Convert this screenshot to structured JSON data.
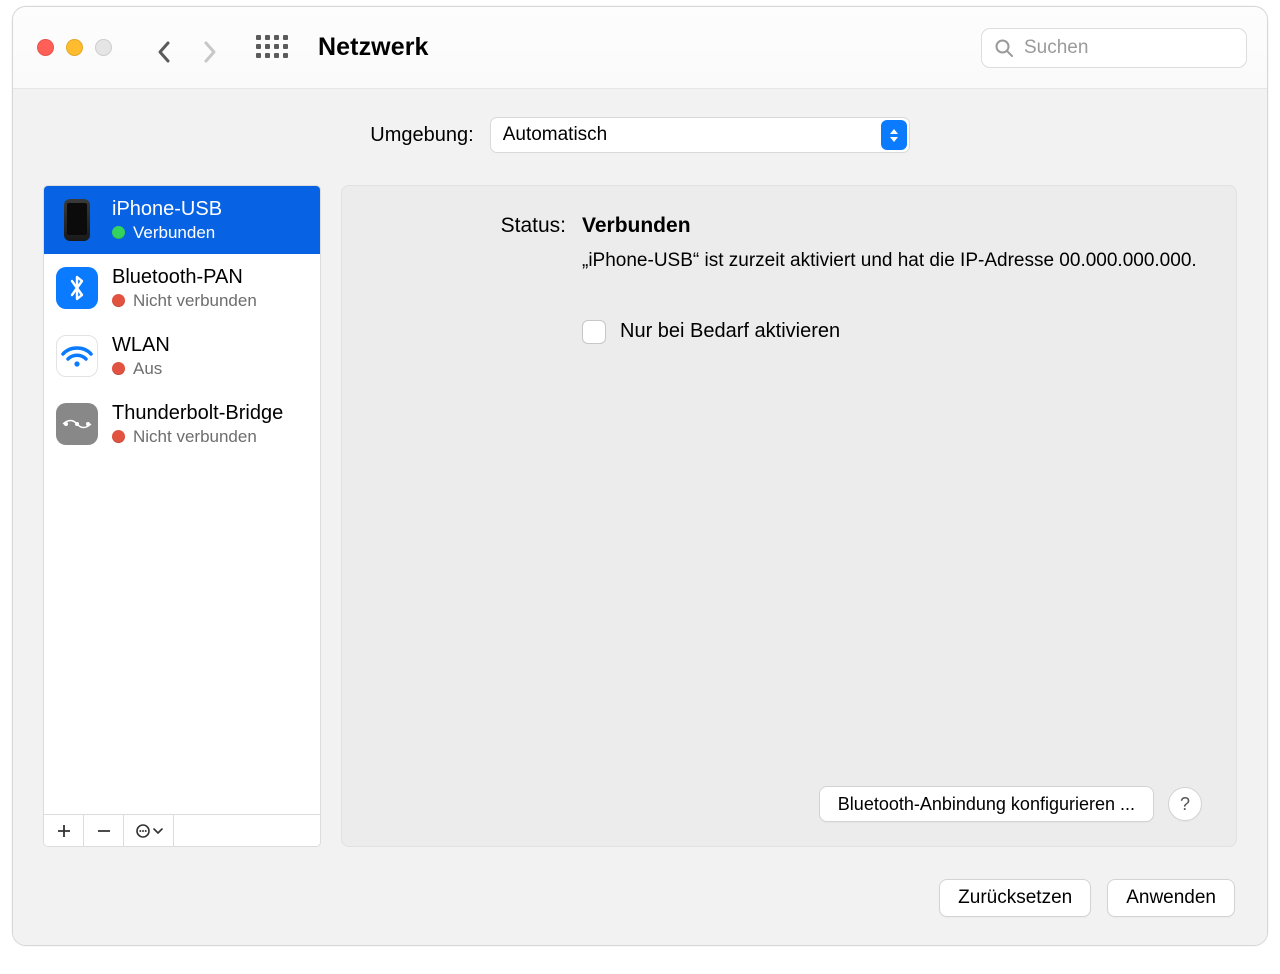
{
  "window": {
    "title": "Netzwerk"
  },
  "search": {
    "placeholder": "Suchen"
  },
  "location": {
    "label": "Umgebung:",
    "value": "Automatisch"
  },
  "interfaces": [
    {
      "name": "iPhone-USB",
      "status": "Verbunden",
      "dot": "green",
      "icon": "iphone",
      "selected": true
    },
    {
      "name": "Bluetooth-PAN",
      "status": "Nicht verbunden",
      "dot": "red",
      "icon": "bluetooth",
      "selected": false
    },
    {
      "name": "WLAN",
      "status": "Aus",
      "dot": "red",
      "icon": "wifi",
      "selected": false
    },
    {
      "name": "Thunderbolt-Bridge",
      "status": "Nicht verbunden",
      "dot": "red",
      "icon": "thunderbolt",
      "selected": false
    }
  ],
  "detail": {
    "status_label": "Status:",
    "status_value": "Verbunden",
    "status_desc": "„iPhone-USB“ ist zurzeit aktiviert und hat die IP-Adresse 00.000.000.000.",
    "checkbox_label": "Nur bei Bedarf aktivieren",
    "checkbox_checked": false,
    "configure_button": "Bluetooth-Anbindung konfigurieren ...",
    "help_button": "?"
  },
  "footer": {
    "revert": "Zurücksetzen",
    "apply": "Anwenden"
  },
  "colors": {
    "selection": "#0762e4",
    "accent": "#0a7bff",
    "status_green": "#31c858",
    "status_red": "#e25241"
  }
}
